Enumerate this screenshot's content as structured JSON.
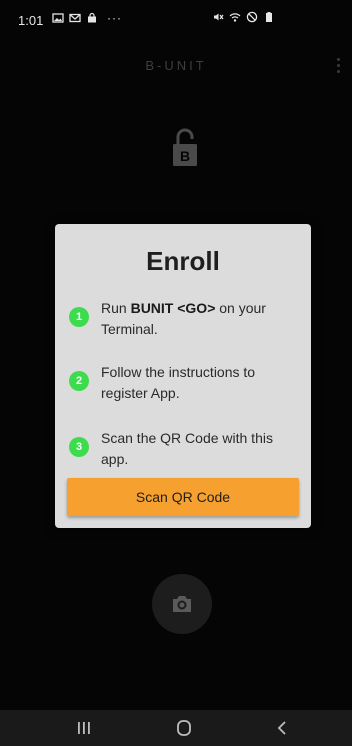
{
  "status_bar": {
    "time": "1:01",
    "left_icons": [
      "gallery-icon",
      "gmail-icon",
      "shop-icon"
    ],
    "more_indicator": "···",
    "right_icons": [
      "mute-icon",
      "wifi-icon",
      "dnd-icon",
      "battery-icon"
    ]
  },
  "app_bar": {
    "title": "B-UNIT",
    "menu_icon": "overflow-menu-icon"
  },
  "lock_icon": {
    "letter": "B"
  },
  "dialog": {
    "title": "Enroll",
    "steps": [
      {
        "number": "1",
        "text_prefix": "Run ",
        "text_bold": "BUNIT <GO>",
        "text_suffix": " on your Terminal."
      },
      {
        "number": "2",
        "text": "Follow the instructions to register App."
      },
      {
        "number": "3",
        "text": "Scan the QR Code with this app."
      }
    ],
    "button_label": "Scan QR Code"
  },
  "colors": {
    "accent": "#f6a12f",
    "step_badge": "#3ddc4e",
    "dialog_bg": "#dcdcdc",
    "background": "#050505"
  },
  "navigation": {
    "buttons": [
      "recents-icon",
      "home-icon",
      "back-icon"
    ]
  }
}
